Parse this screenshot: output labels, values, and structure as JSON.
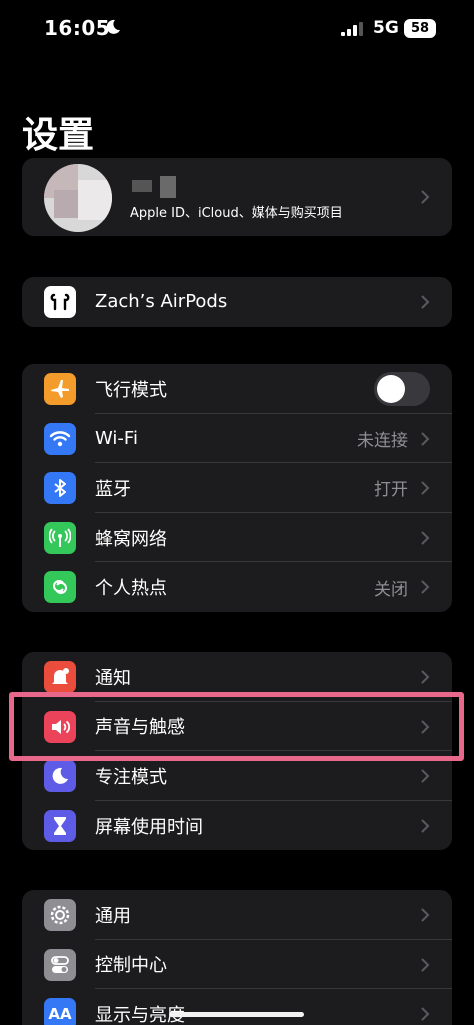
{
  "status_bar": {
    "time": "16:05",
    "network": "5G",
    "battery": "58"
  },
  "page": {
    "title": "设置"
  },
  "profile": {
    "subtitle": "Apple ID、iCloud、媒体与购买项目"
  },
  "airpods": {
    "label": "Zach’s AirPods"
  },
  "connectivity": [
    {
      "label": "飞行模式",
      "icon": "airplane-icon",
      "color": "#f39c2b",
      "toggle": false
    },
    {
      "label": "Wi-Fi",
      "icon": "wifi-icon",
      "color": "#3478f6",
      "value": "未连接"
    },
    {
      "label": "蓝牙",
      "icon": "bluetooth-icon",
      "color": "#3478f6",
      "value": "打开"
    },
    {
      "label": "蜂窝网络",
      "icon": "cellular-icon",
      "color": "#34c759"
    },
    {
      "label": "个人热点",
      "icon": "hotspot-icon",
      "color": "#34c759",
      "value": "关闭"
    }
  ],
  "notifications_group": [
    {
      "label": "通知",
      "icon": "notification-icon",
      "color": "#eb4d3d"
    },
    {
      "label": "声音与触感",
      "icon": "sound-icon",
      "color": "#eb445a"
    },
    {
      "label": "专注模式",
      "icon": "moon-icon",
      "color": "#5e5ce6"
    },
    {
      "label": "屏幕使用时间",
      "icon": "hourglass-icon",
      "color": "#5e5ce6"
    }
  ],
  "general_group": [
    {
      "label": "通用",
      "icon": "gear-icon",
      "color": "#8e8e93"
    },
    {
      "label": "控制中心",
      "icon": "control-center-icon",
      "color": "#8e8e93"
    },
    {
      "label": "显示与亮度",
      "icon": "display-icon",
      "color": "#3478f6",
      "icon_text": "AA"
    }
  ],
  "highlight_color": "#e8688b"
}
